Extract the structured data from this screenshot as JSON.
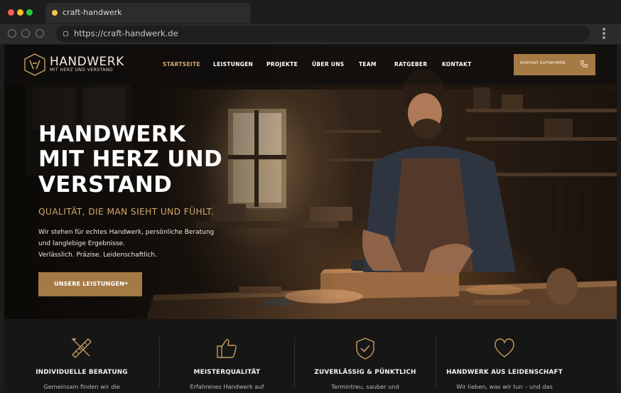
{
  "browser": {
    "tab_title": "craft-handwerk",
    "url": "https://craft-handwerk.de"
  },
  "header": {
    "logo_title": "HANDWERK",
    "logo_subtitle": "MIT HERZ UND VERSTAND",
    "nav": [
      {
        "label": "STARTSEITE",
        "active": true
      },
      {
        "label": "LEISTUNGEN",
        "active": false
      },
      {
        "label": "PROJEKTE",
        "active": false
      },
      {
        "label": "ÜBER UNS",
        "active": false
      },
      {
        "label": "TEAM",
        "active": false
      },
      {
        "label": "RATGEBER",
        "active": false
      },
      {
        "label": "KONTAKT",
        "active": false
      }
    ],
    "cta_label": "KONTAKT AUFNEHMEN",
    "cta_icon": "phone-icon"
  },
  "hero": {
    "headline": [
      "HANDWERK",
      "MIT HERZ UND",
      "VERSTAND"
    ],
    "tagline": "QUALITÄT, DIE MAN SIEHT UND FÜHLT.",
    "description": [
      "Wir stehen für echtes Handwerk, persönliche Beratung",
      "und langlebige Ergebnisse.",
      "Verlässlich. Präzise. Leidenschaftlich."
    ],
    "button_label": "UNSERE LEISTUNGEN",
    "button_arrow": "→"
  },
  "features": [
    {
      "icon": "ruler-pencil-icon",
      "title": "INDIVIDUELLE BERATUNG",
      "text": "Gemeinsam finden wir die"
    },
    {
      "icon": "thumbs-up-icon",
      "title": "MEISTERQUALITÄT",
      "text": "Erfahrenes Handwerk auf"
    },
    {
      "icon": "shield-check-icon",
      "title": "ZUVERLÄSSIG & PÜNKTLICH",
      "text": "Termintreu, sauber und"
    },
    {
      "icon": "heart-icon",
      "title": "HANDWERK AUS LEIDENSCHAFT",
      "text": "Wir lieben, was wir tun – und das"
    }
  ],
  "colors": {
    "accent": "#a57a45",
    "accent_text": "#d4a86b",
    "background": "#151310"
  }
}
